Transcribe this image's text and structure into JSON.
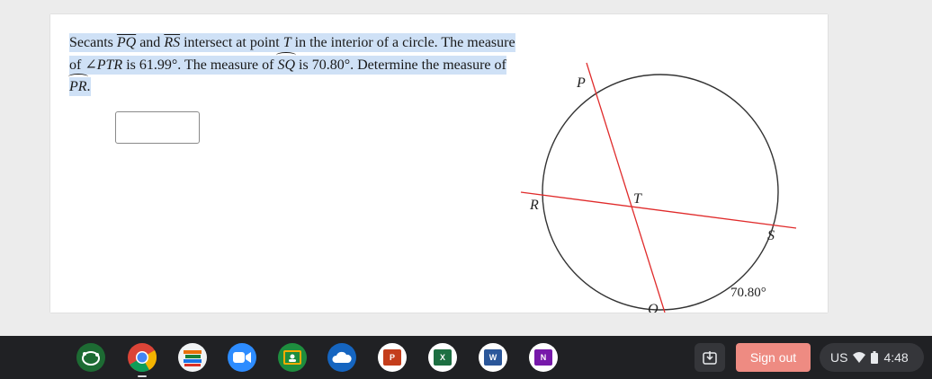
{
  "question": {
    "t1": "Secants ",
    "seg1": "PQ",
    "t2": " and ",
    "seg2": "RS",
    "t3": " intersect at point ",
    "pointT": "T",
    "t4": " in the interior of a circle. The measure of ∠",
    "angle": "PTR",
    "t5": " is 61.99°. The measure of ",
    "arc1": "SQ",
    "t6": " is 70.80°. Determine the measure of ",
    "arc2": "PR",
    "t7": "."
  },
  "answer": {
    "value": ""
  },
  "diagram": {
    "labels": {
      "P": "P",
      "R": "R",
      "T": "T",
      "S": "S",
      "Q": "Q"
    },
    "arc_measure": "70.80°",
    "colors": {
      "circle": "#333333",
      "secant": "#e02b2b"
    }
  },
  "taskbar": {
    "apps": [
      {
        "name": "geogebra",
        "color": "#1d6b33"
      },
      {
        "name": "chrome",
        "color": "#4285f4"
      },
      {
        "name": "books",
        "color": "#f1f3f4"
      },
      {
        "name": "zoom",
        "color": "#2d8cff"
      },
      {
        "name": "classroom",
        "color": "#1e8e3e"
      },
      {
        "name": "onedrive",
        "color": "#1565c0"
      },
      {
        "name": "powerpoint",
        "color": "#c43e1c",
        "glyph": "P"
      },
      {
        "name": "excel",
        "color": "#1d6f42",
        "glyph": "X"
      },
      {
        "name": "word",
        "color": "#2b579a",
        "glyph": "W"
      },
      {
        "name": "onenote",
        "color": "#7719aa",
        "glyph": "N"
      }
    ],
    "signout_label": "Sign out",
    "locale": "US",
    "time": "4:48"
  }
}
